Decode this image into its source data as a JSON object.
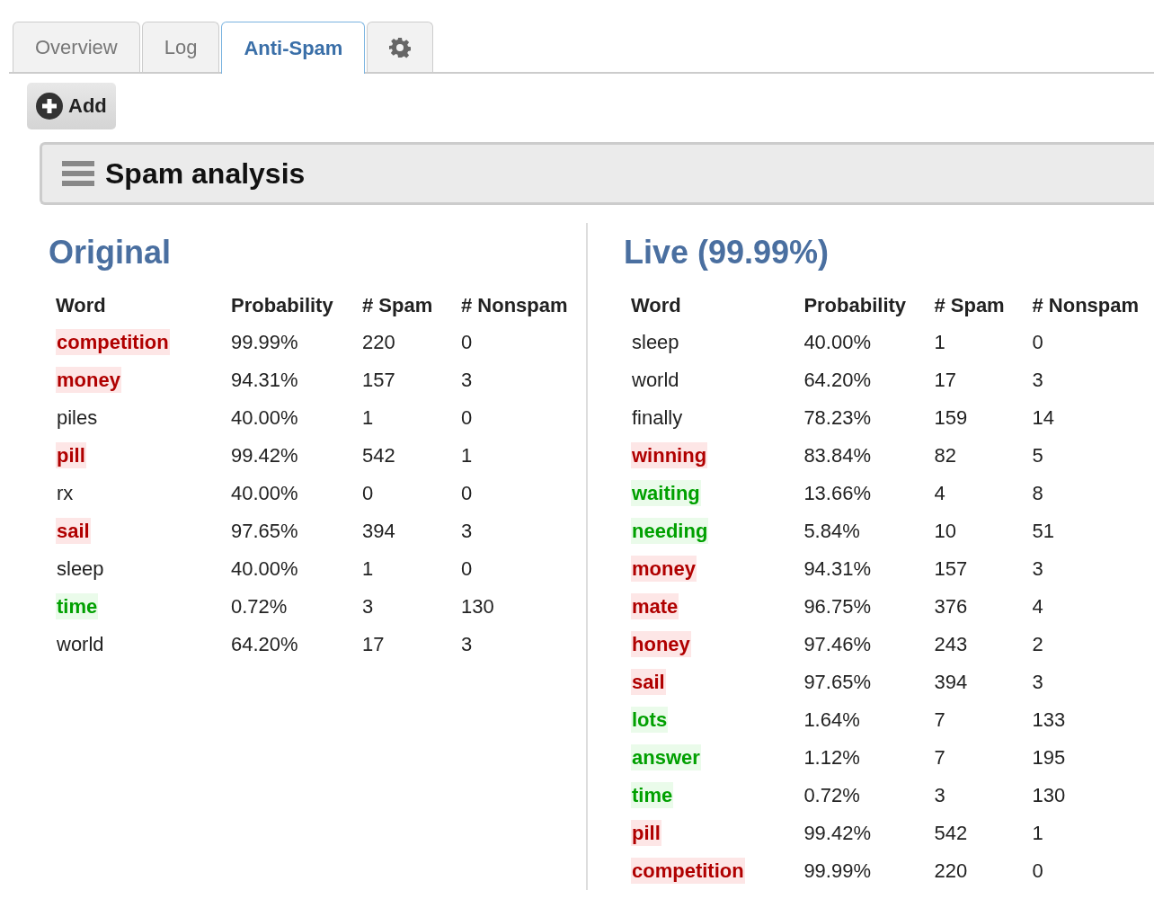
{
  "tabs": [
    {
      "label": "Overview",
      "kind": "text",
      "selected": false
    },
    {
      "label": "Log",
      "kind": "text",
      "selected": false
    },
    {
      "label": "Anti-Spam",
      "kind": "text",
      "selected": true
    },
    {
      "kind": "gear",
      "selected": false
    }
  ],
  "add_button": "Add",
  "panel": {
    "title": "Spam analysis"
  },
  "tables": [
    {
      "title": "Original",
      "columns": [
        "Word",
        "Probability",
        "# Spam",
        "# Nonspam"
      ],
      "rows": [
        {
          "kind": "spam",
          "cells": [
            "competition",
            "99.99%",
            "220",
            "0"
          ]
        },
        {
          "kind": "spam",
          "cells": [
            "money",
            "94.31%",
            "157",
            "3"
          ]
        },
        {
          "kind": "neutral",
          "cells": [
            "piles",
            "40.00%",
            "1",
            "0"
          ]
        },
        {
          "kind": "spam",
          "cells": [
            "pill",
            "99.42%",
            "542",
            "1"
          ]
        },
        {
          "kind": "neutral",
          "cells": [
            "rx",
            "40.00%",
            "0",
            "0"
          ]
        },
        {
          "kind": "spam",
          "cells": [
            "sail",
            "97.65%",
            "394",
            "3"
          ]
        },
        {
          "kind": "neutral",
          "cells": [
            "sleep",
            "40.00%",
            "1",
            "0"
          ]
        },
        {
          "kind": "ham",
          "cells": [
            "time",
            "0.72%",
            "3",
            "130"
          ]
        },
        {
          "kind": "neutral",
          "cells": [
            "world",
            "64.20%",
            "17",
            "3"
          ]
        }
      ]
    },
    {
      "title": "Live (99.99%)",
      "columns": [
        "Word",
        "Probability",
        "# Spam",
        "# Nonspam"
      ],
      "rows": [
        {
          "kind": "neutral",
          "cells": [
            "sleep",
            "40.00%",
            "1",
            "0"
          ]
        },
        {
          "kind": "neutral",
          "cells": [
            "world",
            "64.20%",
            "17",
            "3"
          ]
        },
        {
          "kind": "neutral",
          "cells": [
            "finally",
            "78.23%",
            "159",
            "14"
          ]
        },
        {
          "kind": "spam",
          "cells": [
            "winning",
            "83.84%",
            "82",
            "5"
          ]
        },
        {
          "kind": "ham",
          "cells": [
            "waiting",
            "13.66%",
            "4",
            "8"
          ]
        },
        {
          "kind": "ham",
          "cells": [
            "needing",
            "5.84%",
            "10",
            "51"
          ]
        },
        {
          "kind": "spam",
          "cells": [
            "money",
            "94.31%",
            "157",
            "3"
          ]
        },
        {
          "kind": "spam",
          "cells": [
            "mate",
            "96.75%",
            "376",
            "4"
          ]
        },
        {
          "kind": "spam",
          "cells": [
            "honey",
            "97.46%",
            "243",
            "2"
          ]
        },
        {
          "kind": "spam",
          "cells": [
            "sail",
            "97.65%",
            "394",
            "3"
          ]
        },
        {
          "kind": "ham",
          "cells": [
            "lots",
            "1.64%",
            "7",
            "133"
          ]
        },
        {
          "kind": "ham",
          "cells": [
            "answer",
            "1.12%",
            "7",
            "195"
          ]
        },
        {
          "kind": "ham",
          "cells": [
            "time",
            "0.72%",
            "3",
            "130"
          ]
        },
        {
          "kind": "spam",
          "cells": [
            "pill",
            "99.42%",
            "542",
            "1"
          ]
        },
        {
          "kind": "spam",
          "cells": [
            "competition",
            "99.99%",
            "220",
            "0"
          ]
        }
      ]
    }
  ]
}
